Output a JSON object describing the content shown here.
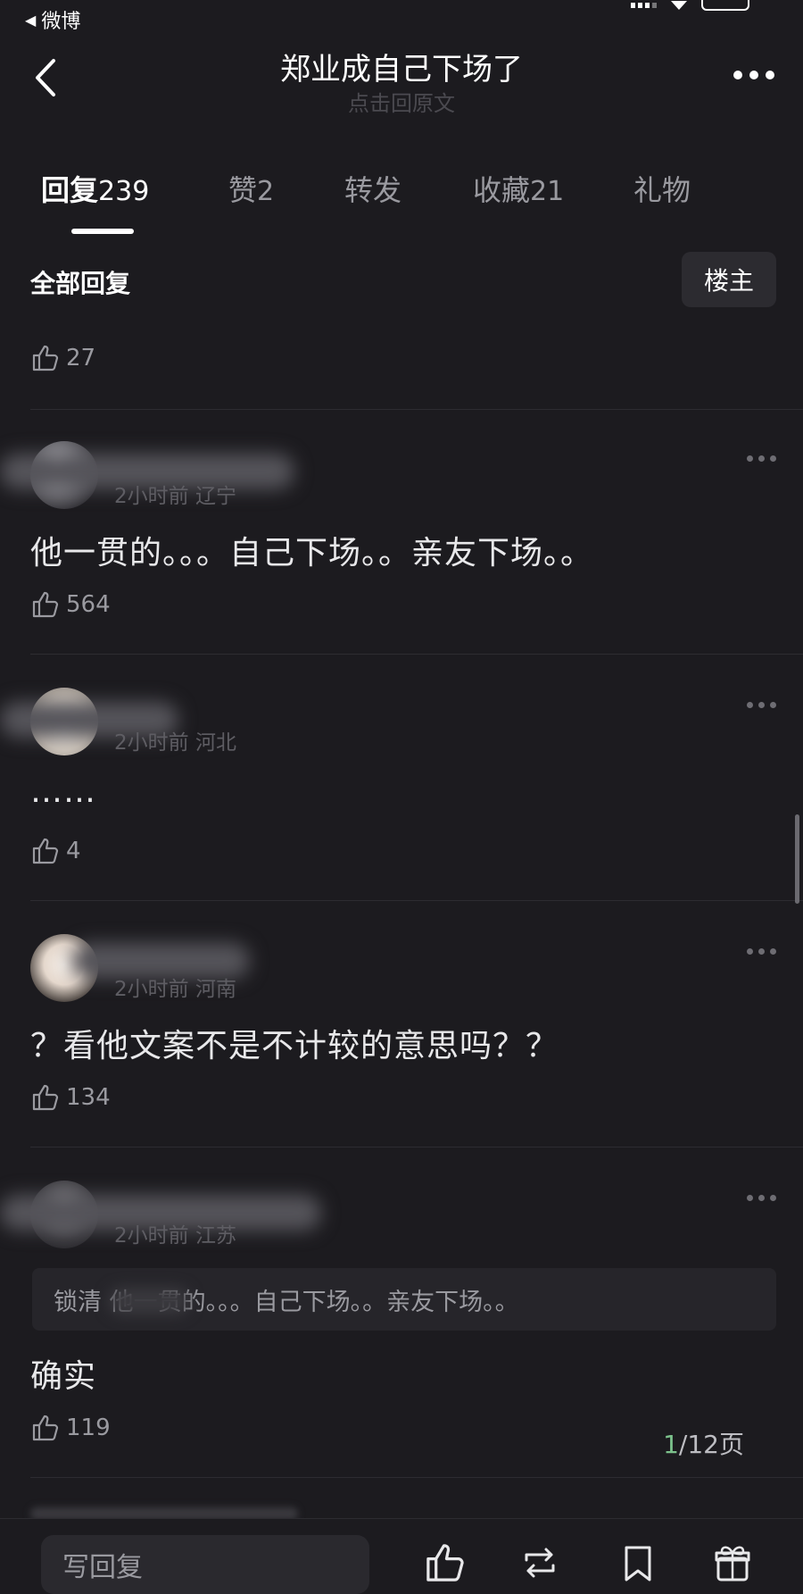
{
  "status": {
    "back_app": "微博"
  },
  "nav": {
    "title": "郑业成自己下场了",
    "subtitle": "点击回原文"
  },
  "tabs": [
    {
      "label": "回复",
      "count": "239"
    },
    {
      "label": "赞",
      "count": "2"
    },
    {
      "label": "转发",
      "count": ""
    },
    {
      "label": "收藏",
      "count": "21"
    },
    {
      "label": "礼物",
      "count": ""
    }
  ],
  "section": {
    "title": "全部回复",
    "owner_button": "楼主"
  },
  "prev_like": "27",
  "comments": [
    {
      "time": "2小时前",
      "location": "辽宁",
      "text": "他一贯的。。。自己下场。。亲友下场。。",
      "likes": "564"
    },
    {
      "time": "2小时前",
      "location": "河北",
      "text": "……",
      "likes": "4"
    },
    {
      "time": "2小时前",
      "location": "河南",
      "text": "？看他文案不是不计较的意思吗？？",
      "likes": "134"
    },
    {
      "time": "2小时前",
      "location": "江苏",
      "quote_text": "锁清    他一贯的。。。自己下场。。亲友下场。。",
      "text": "确实",
      "likes": "119"
    }
  ],
  "pager": {
    "current": "1",
    "total": "/12页"
  },
  "bottom": {
    "write_placeholder": "写回复"
  }
}
